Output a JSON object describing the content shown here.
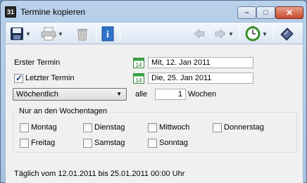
{
  "window": {
    "title": "Termine kopieren",
    "app_icon": "calendar-app-icon",
    "app_icon_text": "31",
    "controls": {
      "minimize": "–",
      "maximize": "□",
      "close": "✕"
    }
  },
  "toolbar": {
    "items": [
      "save-icon",
      "print-icon",
      "delete-icon",
      "info-icon",
      "back-arrow-icon",
      "forward-arrow-icon",
      "clock-icon",
      "book-icon"
    ],
    "info_text": "i"
  },
  "form": {
    "first_date": {
      "label": "Erster Termin",
      "value": "Mit, 12. Jan 2011",
      "cal_day": "14"
    },
    "last_date": {
      "label": "Letzter Termin",
      "checked": true,
      "value": "Die, 25. Jan 2011",
      "cal_day": "14"
    },
    "recurrence": {
      "selected": "Wöchentlich",
      "alle_label": "alle",
      "count": "1",
      "unit": "Wochen"
    },
    "weekdays_group": {
      "title": "Nur an den Wochentagen",
      "days": [
        "Montag",
        "Dienstag",
        "Mittwoch",
        "Donnerstag",
        "Freitag",
        "Samstag",
        "Sonntag"
      ]
    }
  },
  "summary": "Täglich vom 12.01.2011 bis 25.01.2011 00:00 Uhr"
}
